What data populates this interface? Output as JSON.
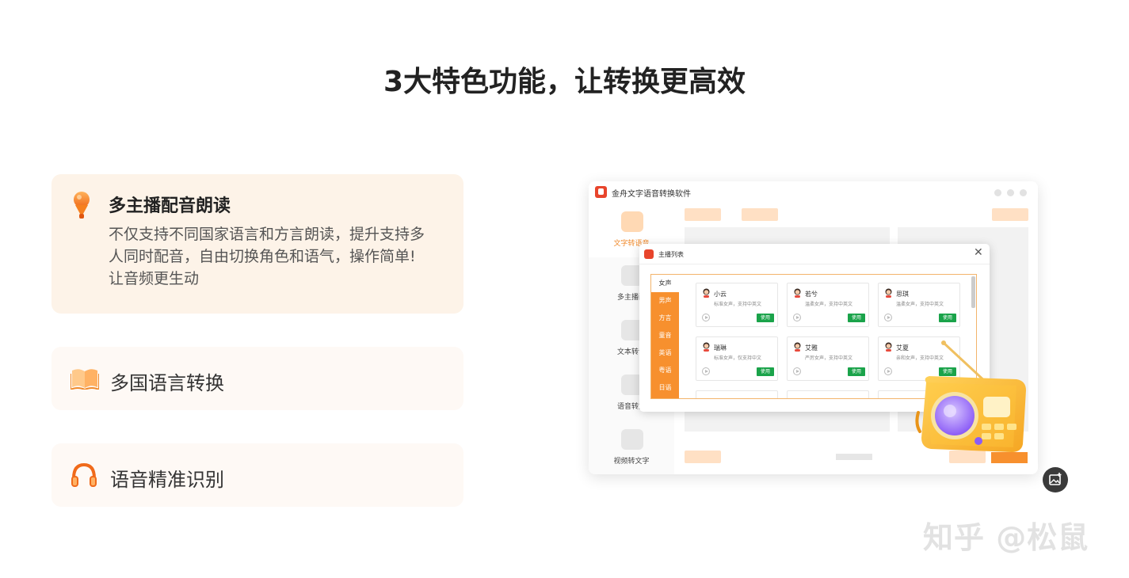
{
  "headline": "3大特色功能，让转换更高效",
  "features": [
    {
      "title": "多主播配音朗读",
      "description": "不仅支持不同国家语言和方言朗读，提升支持多人同时配音，自由切换角色和语气，操作简单!让音频更生动",
      "icon": "microphone-icon"
    },
    {
      "title": "多国语言转换",
      "icon": "book-icon"
    },
    {
      "title": "语音精准识别",
      "icon": "headphones-icon"
    }
  ],
  "app": {
    "title": "金舟文字语音转换软件",
    "sidebar": [
      {
        "label": "文字转语音"
      },
      {
        "label": "多主播配"
      },
      {
        "label": "文本转语"
      },
      {
        "label": "语音转文"
      },
      {
        "label": "视频转文字"
      }
    ],
    "dialog": {
      "title": "主播列表",
      "close": "✕",
      "categories": [
        "女声",
        "男声",
        "方言",
        "童音",
        "英语",
        "粤语",
        "日语"
      ],
      "voices": [
        {
          "name": "小云",
          "desc": "标准女声，支持中英文",
          "action": "使用"
        },
        {
          "name": "若兮",
          "desc": "温柔女声，支持中英文",
          "action": "使用"
        },
        {
          "name": "思琪",
          "desc": "温柔女声，支持中英文",
          "action": "使用"
        },
        {
          "name": "瑞琳",
          "desc": "标准女声，仅支持中文",
          "action": "使用"
        },
        {
          "name": "艾雅",
          "desc": "严厉女声，支持中英文",
          "action": "使用"
        },
        {
          "name": "艾夏",
          "desc": "亲和女声，支持中英文",
          "action": "使用"
        }
      ]
    }
  },
  "watermark": "知乎 @松鼠",
  "colors": {
    "accent": "#f7902e",
    "use_button": "#1aa34a",
    "card_active": "#fdf3e8"
  }
}
